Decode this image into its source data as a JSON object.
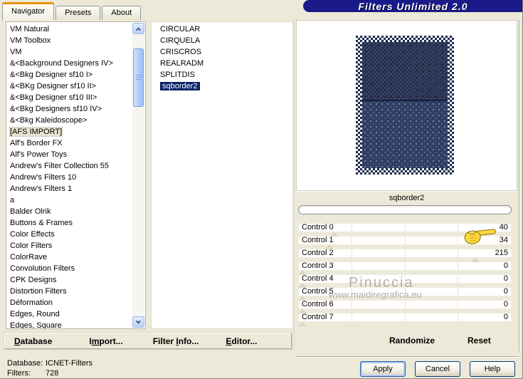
{
  "window": {
    "title": "Filters Unlimited 2.0"
  },
  "tabs": [
    {
      "label": "Navigator",
      "active": true
    },
    {
      "label": "Presets",
      "active": false
    },
    {
      "label": "About",
      "active": false
    }
  ],
  "category_list": {
    "items": [
      "VM Natural",
      "VM Toolbox",
      "VM",
      "&<Background Designers IV>",
      "&<Bkg Designer sf10 I>",
      "&<BKg Designer sf10 II>",
      "&<Bkg Designer sf10 III>",
      "&<Bkg Designers sf10 IV>",
      "&<Bkg Kaleidoscope>",
      "[AFS IMPORT]",
      "Alf's Border FX",
      "Alf's Power Toys",
      "Andrew's Filter Collection 55",
      "Andrew's Filters 10",
      "Andrew's Filters 1",
      "a",
      "Balder Olrik",
      "Buttons & Frames",
      "Color Effects",
      "Color Filters",
      "ColorRave",
      "Convolution Filters",
      "CPK Designs",
      "Distortion Filters",
      "Déformation",
      "Edges, Round",
      "Edges, Square"
    ],
    "selected": "[AFS IMPORT]"
  },
  "filter_list": {
    "items": [
      "CIRCULAR",
      "CIRQUELA",
      "CRISCROS",
      "REALRADM",
      "SPLITDIS",
      "sqborder2"
    ],
    "selected": "sqborder2"
  },
  "preview": {
    "caption": "sqborder2"
  },
  "controls": [
    {
      "label": "Control 0",
      "value": 40
    },
    {
      "label": "Control 1",
      "value": 34
    },
    {
      "label": "Control 2",
      "value": 215
    },
    {
      "label": "Control 3",
      "value": 0
    },
    {
      "label": "Control 4",
      "value": 0
    },
    {
      "label": "Control 5",
      "value": 0
    },
    {
      "label": "Control 6",
      "value": 0
    },
    {
      "label": "Control 7",
      "value": 0
    }
  ],
  "controls_max": 255,
  "menu": [
    {
      "pre": "",
      "u": "D",
      "post": "atabase"
    },
    {
      "pre": "I",
      "u": "m",
      "post": "port..."
    },
    {
      "pre": "Filter ",
      "u": "I",
      "post": "nfo..."
    },
    {
      "pre": "",
      "u": "E",
      "post": "ditor..."
    }
  ],
  "actions": {
    "randomize": "Randomize",
    "reset": "Reset"
  },
  "buttons": {
    "apply": "Apply",
    "cancel": "Cancel",
    "help": "Help"
  },
  "status": {
    "database_label": "Database:",
    "database_value": "ICNET-Filters",
    "filters_label": "Filters:",
    "filters_value": "728"
  },
  "watermark": {
    "name": "Pinuccia",
    "site": "www.maidiregrafica.eu"
  },
  "colors": {
    "banner": "#1a1a8a",
    "selection": "#0a246a",
    "tab_accent": "#e5940e",
    "dialog_face": "#ece9d8",
    "pattern_dark": "#2a3457",
    "pattern_light": "#2f3e63",
    "hand": "#ffd83d"
  }
}
